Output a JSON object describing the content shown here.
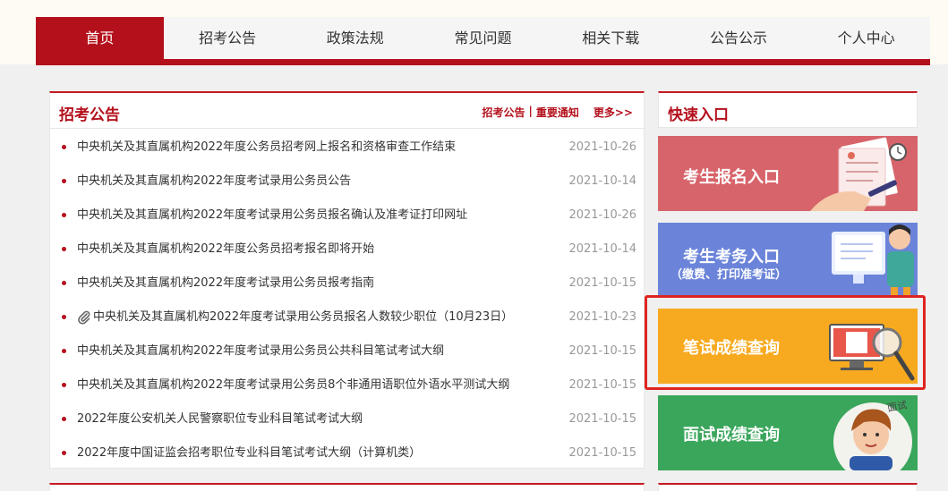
{
  "nav": {
    "items": [
      {
        "label": "首页"
      },
      {
        "label": "招考公告"
      },
      {
        "label": "政策法规"
      },
      {
        "label": "常见问题"
      },
      {
        "label": "相关下载"
      },
      {
        "label": "公告公示"
      },
      {
        "label": "个人中心"
      }
    ],
    "active": "首页"
  },
  "announcements": {
    "title": "招考公告",
    "link_recruit": "招考公告",
    "separator": "|",
    "link_notice": "重要通知",
    "more": "更多>>",
    "items": [
      {
        "title": "中央机关及其直属机构2022年度公务员招考网上报名和资格审查工作结束",
        "date": "2021-10-26"
      },
      {
        "title": "中央机关及其直属机构2022年度考试录用公务员公告",
        "date": "2021-10-14"
      },
      {
        "title": "中央机关及其直属机构2022年度考试录用公务员报名确认及准考证打印网址",
        "date": "2021-10-26"
      },
      {
        "title": "中央机关及其直属机构2022年度公务员招考报名即将开始",
        "date": "2021-10-14"
      },
      {
        "title": "中央机关及其直属机构2022年度考试录用公务员报考指南",
        "date": "2021-10-15"
      },
      {
        "title": "中央机关及其直属机构2022年度考试录用公务员报名人数较少职位（10月23日）",
        "date": "2021-10-23",
        "icon": "paperclip-icon"
      },
      {
        "title": "中央机关及其直属机构2022年度考试录用公务员公共科目笔试考试大纲",
        "date": "2021-10-15"
      },
      {
        "title": "中央机关及其直属机构2022年度考试录用公务员8个非通用语职位外语水平测试大纲",
        "date": "2021-10-15"
      },
      {
        "title": "2022年度公安机关人民警察职位专业科目笔试考试大纲",
        "date": "2021-10-15"
      },
      {
        "title": "2022年度中国证监会招考职位专业科目笔试考试大纲（计算机类）",
        "date": "2021-10-15"
      }
    ]
  },
  "quick": {
    "title": "快速入口",
    "tiles": [
      {
        "label": "考生报名入口",
        "color": "#d7646a",
        "icon": "application-form-icon"
      },
      {
        "label": "考生考务入口",
        "sub": "（缴费、打印准考证）",
        "color": "#6b84d9",
        "icon": "computer-user-icon"
      },
      {
        "label": "笔试成绩查询",
        "color": "#f7aa1f",
        "icon": "magnifier-screen-icon"
      },
      {
        "label": "面试成绩查询",
        "color": "#3aa65b",
        "icon": "interview-person-icon"
      }
    ],
    "interview_badge": "面试"
  },
  "colors": {
    "brand": "#b4101c",
    "highlight": "#e0241f"
  }
}
